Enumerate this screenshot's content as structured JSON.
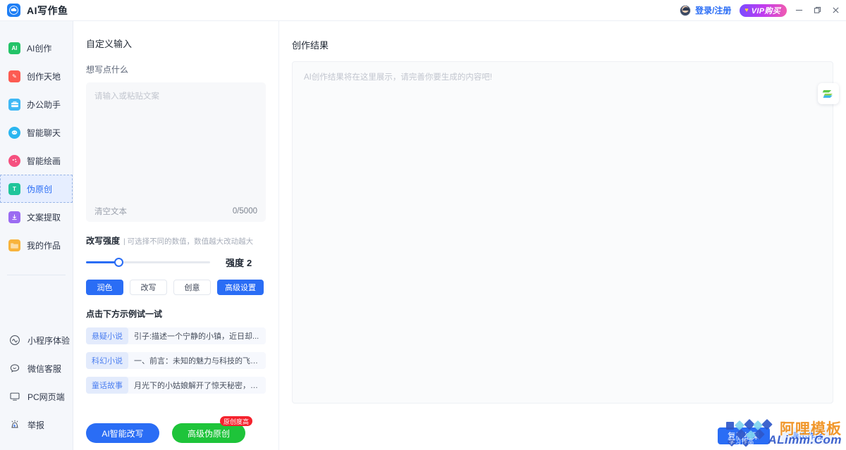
{
  "titlebar": {
    "logo_icon": "cloud-logo-icon",
    "app_title": "AI写作鱼",
    "avatar_icon": "user-avatar",
    "login_label": "登录/注册",
    "vip_label": "VIP购买",
    "vip_icon": "heart-icon",
    "minimize_icon": "minimize-icon",
    "maximize_icon": "maximize-icon",
    "close_icon": "close-icon",
    "accent_color": "#2a6df5"
  },
  "sidebar": {
    "top_items": [
      {
        "label": "AI创作",
        "icon": "ai-create-icon",
        "color": "#23c368",
        "glyph": "AI",
        "active": false
      },
      {
        "label": "创作天地",
        "icon": "pencil-icon",
        "color": "#fc5b52",
        "glyph": "✎",
        "active": false
      },
      {
        "label": "办公助手",
        "icon": "briefcase-icon",
        "color": "#3fb8f5",
        "glyph": "▤",
        "active": false
      },
      {
        "label": "智能聊天",
        "icon": "chat-bubble-icon",
        "color": "#2bb6f0",
        "glyph": "◎",
        "active": false
      },
      {
        "label": "智能绘画",
        "icon": "palette-icon",
        "color": "#f5507f",
        "glyph": "✺",
        "active": false
      },
      {
        "label": "伪原创",
        "icon": "rewrite-icon",
        "color": "#1fc59b",
        "glyph": "T",
        "active": true
      },
      {
        "label": "文案提取",
        "icon": "extract-icon",
        "color": "#9b6bf2",
        "glyph": "↧",
        "active": false
      },
      {
        "label": "我的作品",
        "icon": "folder-icon",
        "color": "#f8b33c",
        "glyph": "",
        "active": false
      }
    ],
    "bottom_items": [
      {
        "label": "小程序体验",
        "icon": "miniprogram-icon"
      },
      {
        "label": "微信客服",
        "icon": "wechat-service-icon"
      },
      {
        "label": "PC网页端",
        "icon": "monitor-icon"
      },
      {
        "label": "举报",
        "icon": "alarm-report-icon"
      }
    ]
  },
  "work_panel": {
    "title": "自定义输入",
    "subtitle": "想写点什么",
    "input_placeholder": "请输入或粘贴文案",
    "input_value": "",
    "clear_label": "清空文本",
    "char_count": "0/5000",
    "strength": {
      "title": "改写强度",
      "hint": "| 可选择不同的数值，数值越大改动越大",
      "label": "强度",
      "value": "2",
      "min": 1,
      "max": 8
    },
    "modes": [
      {
        "label": "润色",
        "style": "primary"
      },
      {
        "label": "改写",
        "style": "default"
      },
      {
        "label": "创意",
        "style": "default"
      },
      {
        "label": "高级设置",
        "style": "advanced"
      }
    ],
    "examples_title": "点击下方示例试一试",
    "examples": [
      {
        "tag": "悬疑小说",
        "text": "引子:描述一个宁静的小镇，近日却..."
      },
      {
        "tag": "科幻小说",
        "text": "一、前言：未知的魅力与科技的飞跃..."
      },
      {
        "tag": "童话故事",
        "text": "月光下的小姑娘解开了惊天秘密，竟..."
      }
    ],
    "actions": [
      {
        "label": "AI智能改写",
        "style": "blue",
        "badge": ""
      },
      {
        "label": "高级伪原创",
        "style": "green",
        "badge": "原创度高"
      }
    ]
  },
  "result_panel": {
    "title": "创作结果",
    "placeholder": "AI创作结果将在这里展示，请完善你要生成的内容吧!",
    "value": "",
    "actions": [
      {
        "label": "复制结果",
        "style": "primary"
      },
      {
        "label": "导出作品",
        "style": "ghost"
      }
    ],
    "float_icon": "share-flow-icon"
  },
  "watermark": {
    "main": "阿哩模板",
    "sub": "ALimm.Com",
    "mini": "学习作品"
  }
}
